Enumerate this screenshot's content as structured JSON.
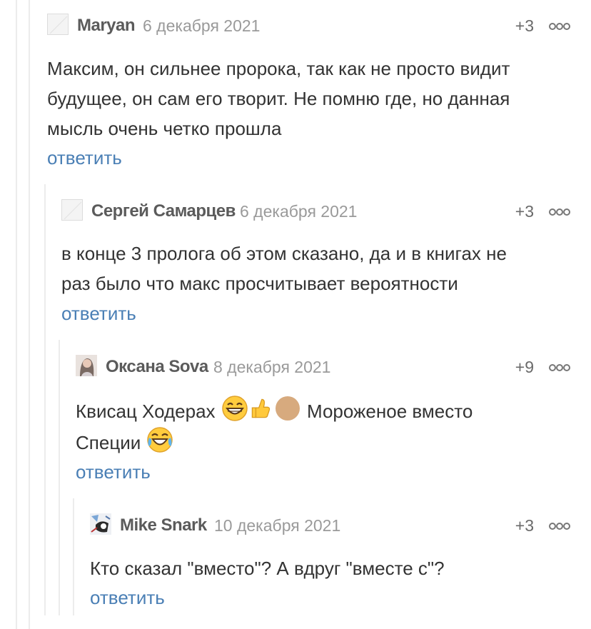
{
  "comments": [
    {
      "author": "Maryan",
      "date": "6 декабря 2021",
      "rating": "+3",
      "text_lines": [
        "Максим, он сильнее пророка, так как не просто видит",
        "будущее, он сам его творит. Не помню где, но данная",
        "мысль очень четко прошла"
      ],
      "reply_label": "ответить"
    },
    {
      "author": "Сергей Самарцев",
      "date": "6 декабря 2021",
      "rating": "+3",
      "text_lines": [
        "в конце 3 пролога об этом сказано, да и в книгах не",
        "раз было что макс просчитывает вероятности"
      ],
      "reply_label": "ответить"
    },
    {
      "author": "Оксана Sova",
      "date": "8 декабря 2021",
      "rating": "+9",
      "text_line1_a": "Квисац Ходерах ",
      "text_line1_b": " Мороженое вместо",
      "text_line2": "Специи ",
      "emojis": [
        "grinning-face-emoji",
        "thumbs-up-emoji",
        "beige-circle-emoji",
        "crying-laughing-emoji"
      ],
      "reply_label": "ответить"
    },
    {
      "author": "Mike Snark",
      "date": "10 декабря 2021",
      "rating": "+3",
      "text_lines": [
        "Кто сказал \"вместо\"? А вдруг \"вместе с\"?"
      ],
      "reply_label": "ответить"
    }
  ],
  "colors": {
    "link": "#4a7fb5",
    "author": "#5b5b5b",
    "date": "#9a9a9a",
    "thread_line": "#ececec"
  }
}
